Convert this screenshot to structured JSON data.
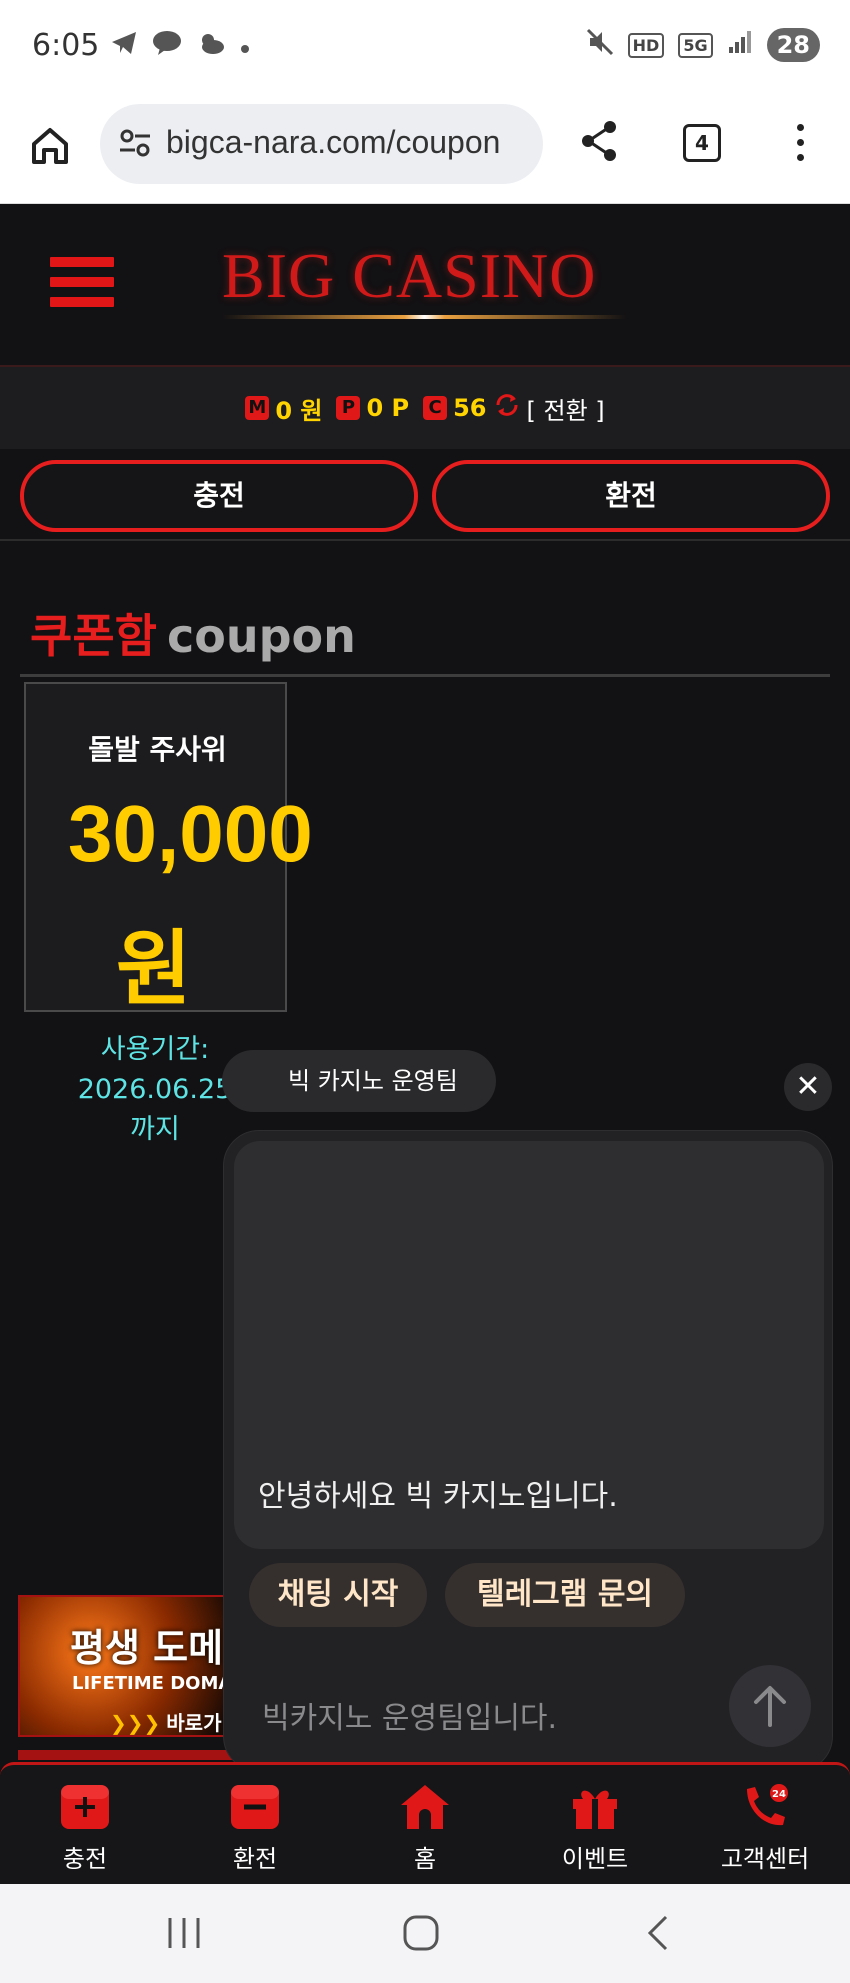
{
  "status_bar": {
    "time": "6:05",
    "battery": "28",
    "hd": "HD",
    "network": "5G"
  },
  "browser": {
    "url": "bigca-nara.com/coupon",
    "tab_count": "4"
  },
  "header": {
    "logo": "BIG CASINO"
  },
  "balance": {
    "money_badge": "M",
    "money": "0 원",
    "point_badge": "P",
    "points": "0 P",
    "coin_badge": "C",
    "coins": "56",
    "convert_label": "[ 전환 ]"
  },
  "actions": {
    "charge": "충전",
    "exchange": "환전"
  },
  "coupon_section": {
    "title_kr": "쿠폰함",
    "title_en": "coupon",
    "card": {
      "name": "돌발 주사위",
      "amount": "30,000",
      "unit": "원"
    },
    "period_label": "사용기간:",
    "period_date": "2026.06.25",
    "period_suffix": "까지"
  },
  "banner": {
    "line1": "평생 도메",
    "line2": "LIFETIME DOMA",
    "line3": "바로가"
  },
  "chat": {
    "sender": "빅 카지노 운영팀",
    "message": "안녕하세요 빅 카지노입니다.",
    "chip_start": "채팅 시작",
    "chip_telegram": "텔레그램 문의",
    "input_placeholder": "빅카지노 운영팀입니다."
  },
  "bottom_nav": [
    {
      "label": "충전",
      "icon": "plus-icon"
    },
    {
      "label": "환전",
      "icon": "minus-icon"
    },
    {
      "label": "홈",
      "icon": "home-icon"
    },
    {
      "label": "이벤트",
      "icon": "gift-icon"
    },
    {
      "label": "고객센터",
      "icon": "phone-24-icon"
    }
  ],
  "colors": {
    "accent_red": "#e61e1e",
    "gold": "#ffcc00",
    "cyan": "#5ee4e4",
    "background": "#121113"
  }
}
